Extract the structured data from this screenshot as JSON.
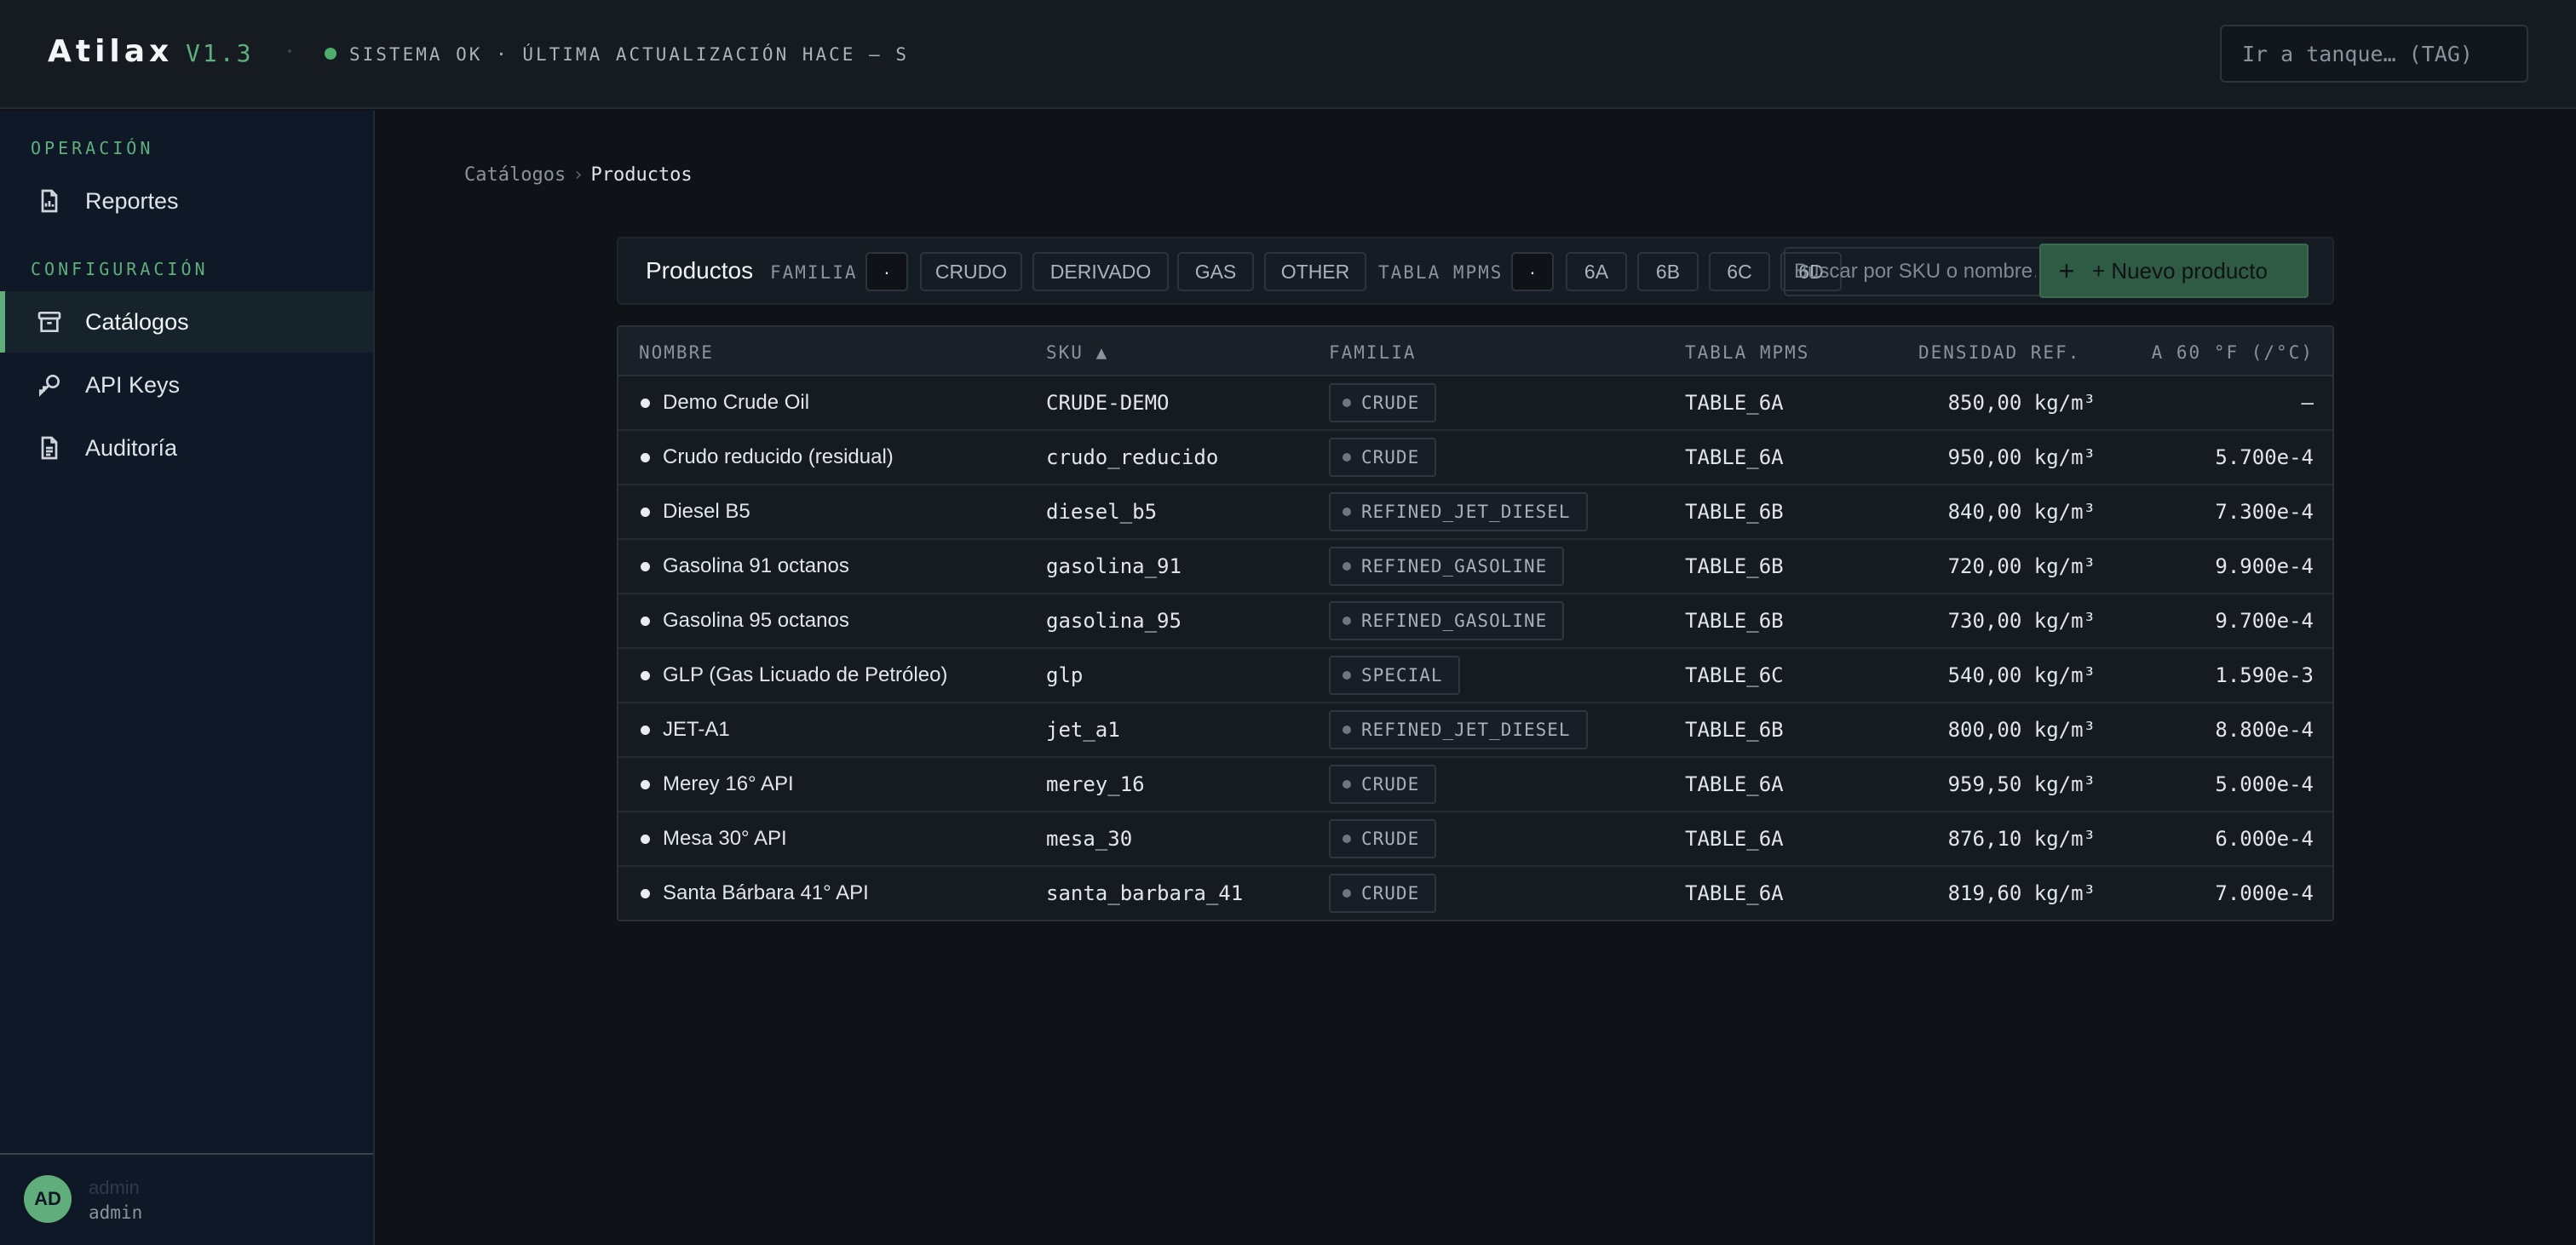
{
  "app": {
    "brand": "Atilax",
    "version": "V1.3",
    "status": "SISTEMA OK · ÚLTIMA ACTUALIZACIÓN HACE — S",
    "status_color": "#4caf6e",
    "accent_color": "#5fae7c",
    "tank_search_placeholder": "Ir a tanque… (TAG)"
  },
  "sidebar": {
    "sections": [
      {
        "title": "OPERACIÓN",
        "items": [
          {
            "label": "Reportes",
            "icon": "report-icon",
            "active": false
          }
        ]
      },
      {
        "title": "CONFIGURACIÓN",
        "items": [
          {
            "label": "Catálogos",
            "icon": "archive-icon",
            "active": true
          },
          {
            "label": "API Keys",
            "icon": "key-icon",
            "active": false
          },
          {
            "label": "Auditoría",
            "icon": "document-icon",
            "active": false
          }
        ]
      }
    ],
    "user": {
      "initials": "AD",
      "name": "admin",
      "role": "admin"
    }
  },
  "breadcrumb": {
    "parent": "Catálogos",
    "separator": "›",
    "current": "Productos"
  },
  "toolbar": {
    "title": "Productos",
    "family_label": "FAMILIA",
    "family_all": "·",
    "family_filters": [
      "CRUDO",
      "DERIVADO",
      "GAS",
      "OTHER"
    ],
    "table_label": "TABLA MPMS",
    "table_all": "·",
    "table_filters": [
      "6A",
      "6B",
      "6C",
      "6D"
    ],
    "search_placeholder": "Buscar por SKU o nombre…",
    "new_plus": "+",
    "new_label": "+ Nuevo producto"
  },
  "table": {
    "headers": {
      "name": "NOMBRE",
      "sku": "SKU ▲",
      "family": "FAMILIA",
      "mpms": "TABLA MPMS",
      "density": "DENSIDAD REF.",
      "alpha": "A 60 °F (/°C)"
    },
    "rows": [
      {
        "name": "Demo Crude Oil",
        "sku": "CRUDE-DEMO",
        "family": "CRUDE",
        "mpms": "TABLE_6A",
        "density": "850,00 kg/m³",
        "alpha": "—"
      },
      {
        "name": "Crudo reducido (residual)",
        "sku": "crudo_reducido",
        "family": "CRUDE",
        "mpms": "TABLE_6A",
        "density": "950,00 kg/m³",
        "alpha": "5.700e-4"
      },
      {
        "name": "Diesel B5",
        "sku": "diesel_b5",
        "family": "REFINED_JET_DIESEL",
        "mpms": "TABLE_6B",
        "density": "840,00 kg/m³",
        "alpha": "7.300e-4"
      },
      {
        "name": "Gasolina 91 octanos",
        "sku": "gasolina_91",
        "family": "REFINED_GASOLINE",
        "mpms": "TABLE_6B",
        "density": "720,00 kg/m³",
        "alpha": "9.900e-4"
      },
      {
        "name": "Gasolina 95 octanos",
        "sku": "gasolina_95",
        "family": "REFINED_GASOLINE",
        "mpms": "TABLE_6B",
        "density": "730,00 kg/m³",
        "alpha": "9.700e-4"
      },
      {
        "name": "GLP (Gas Licuado de Petróleo)",
        "sku": "glp",
        "family": "SPECIAL",
        "mpms": "TABLE_6C",
        "density": "540,00 kg/m³",
        "alpha": "1.590e-3"
      },
      {
        "name": "JET-A1",
        "sku": "jet_a1",
        "family": "REFINED_JET_DIESEL",
        "mpms": "TABLE_6B",
        "density": "800,00 kg/m³",
        "alpha": "8.800e-4"
      },
      {
        "name": "Merey 16° API",
        "sku": "merey_16",
        "family": "CRUDE",
        "mpms": "TABLE_6A",
        "density": "959,50 kg/m³",
        "alpha": "5.000e-4"
      },
      {
        "name": "Mesa 30° API",
        "sku": "mesa_30",
        "family": "CRUDE",
        "mpms": "TABLE_6A",
        "density": "876,10 kg/m³",
        "alpha": "6.000e-4"
      },
      {
        "name": "Santa Bárbara 41° API",
        "sku": "santa_barbara_41",
        "family": "CRUDE",
        "mpms": "TABLE_6A",
        "density": "819,60 kg/m³",
        "alpha": "7.000e-4"
      }
    ]
  }
}
